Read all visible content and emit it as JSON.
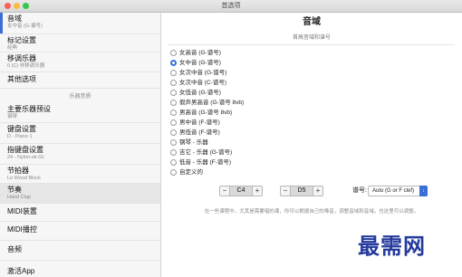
{
  "window": {
    "title": "首选项"
  },
  "sidebar": {
    "items": [
      {
        "label": "音域",
        "sub": "女中音 (G-谱号)",
        "selected": true
      },
      {
        "label": "标记设置",
        "sub": "经典"
      },
      {
        "label": "移调乐器",
        "sub": "0 (C) 非移调乐器"
      },
      {
        "label": "其他选项",
        "sub": ""
      },
      {
        "label": "主要乐器预设",
        "sub": "钢琴"
      },
      {
        "label": "键盘设置",
        "sub": "D - Piano 1"
      },
      {
        "label": "指键盘设置",
        "sub": "24 - Nylon-str.Gt."
      },
      {
        "label": "节拍器",
        "sub": "Lo Wood Block"
      },
      {
        "label": "节奏",
        "sub": "Hand Clap"
      },
      {
        "label": "MIDI装置",
        "sub": ""
      },
      {
        "label": "MIDI播控",
        "sub": ""
      },
      {
        "label": "音频",
        "sub": ""
      },
      {
        "label": "激活App",
        "sub": ""
      }
    ],
    "section_label": "乐器音质"
  },
  "main": {
    "title": "音域",
    "subtitle": "首高音域和谱号",
    "options": [
      {
        "label": "女高音 (G-谱号)",
        "selected": false
      },
      {
        "label": "女中音 (G-谱号)",
        "selected": true
      },
      {
        "label": "女次中音 (G-谱号)",
        "selected": false
      },
      {
        "label": "女次中音 (C-谱号)",
        "selected": false
      },
      {
        "label": "女低音 (G-谱号)",
        "selected": false
      },
      {
        "label": "假声男高音 (G-谱号 8vb)",
        "selected": false
      },
      {
        "label": "男高音 (G-谱号 8vb)",
        "selected": false
      },
      {
        "label": "男中音 (F-谱号)",
        "selected": false
      },
      {
        "label": "男低音 (F-谱号)",
        "selected": false
      },
      {
        "label": "钢琴 - 乐器",
        "selected": false
      },
      {
        "label": "吉它 - 乐器 (G-谱号)",
        "selected": false
      },
      {
        "label": "低音 - 乐器 (F-谱号)",
        "selected": false
      },
      {
        "label": "自定义的",
        "selected": false
      }
    ],
    "low_note": "C4",
    "high_note": "D5",
    "minus_label": "−",
    "plus_label": "+",
    "clef_label": "谱号:",
    "clef_value": "Auto (G or F clef)",
    "footnote": "在一些课程中，尤其是需要唱的课，你可以根据自己的嗓音，调整音域和音域。也这里可以调整。"
  },
  "watermark": "最需网",
  "colors": {
    "accent": "#3b6fd8",
    "watermark": "#243a9c"
  }
}
